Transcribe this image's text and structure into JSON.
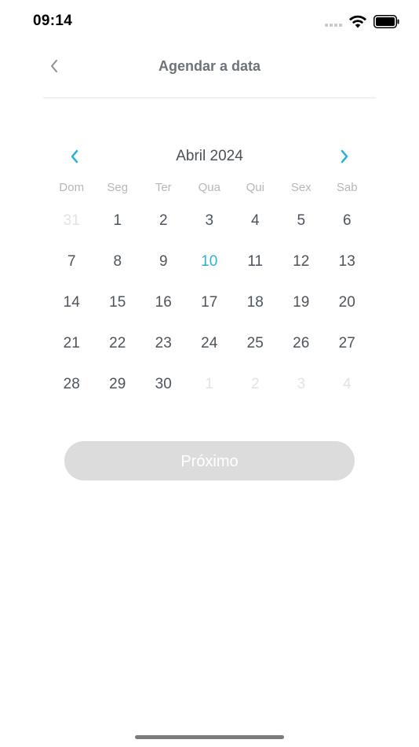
{
  "status_bar": {
    "time": "09:14"
  },
  "header": {
    "title": "Agendar a data",
    "back_icon": "chevron-left-icon"
  },
  "calendar": {
    "month_title": "Abril 2024",
    "prev_icon": "chevron-left-icon",
    "next_icon": "chevron-right-icon",
    "accent_color": "#2bb3d4",
    "weekdays": [
      "Dom",
      "Seg",
      "Ter",
      "Qua",
      "Qui",
      "Sex",
      "Sab"
    ],
    "weeks": [
      [
        {
          "d": "31",
          "muted": true
        },
        {
          "d": "1"
        },
        {
          "d": "2"
        },
        {
          "d": "3"
        },
        {
          "d": "4"
        },
        {
          "d": "5"
        },
        {
          "d": "6"
        }
      ],
      [
        {
          "d": "7"
        },
        {
          "d": "8"
        },
        {
          "d": "9"
        },
        {
          "d": "10",
          "today": true
        },
        {
          "d": "11"
        },
        {
          "d": "12"
        },
        {
          "d": "13"
        }
      ],
      [
        {
          "d": "14"
        },
        {
          "d": "15"
        },
        {
          "d": "16"
        },
        {
          "d": "17"
        },
        {
          "d": "18"
        },
        {
          "d": "19"
        },
        {
          "d": "20"
        }
      ],
      [
        {
          "d": "21"
        },
        {
          "d": "22"
        },
        {
          "d": "23"
        },
        {
          "d": "24"
        },
        {
          "d": "25"
        },
        {
          "d": "26"
        },
        {
          "d": "27"
        }
      ],
      [
        {
          "d": "28"
        },
        {
          "d": "29"
        },
        {
          "d": "30"
        },
        {
          "d": "1",
          "muted": true
        },
        {
          "d": "2",
          "muted": true
        },
        {
          "d": "3",
          "muted": true
        },
        {
          "d": "4",
          "muted": true
        }
      ]
    ]
  },
  "actions": {
    "next_label": "Próximo",
    "next_disabled": true
  }
}
